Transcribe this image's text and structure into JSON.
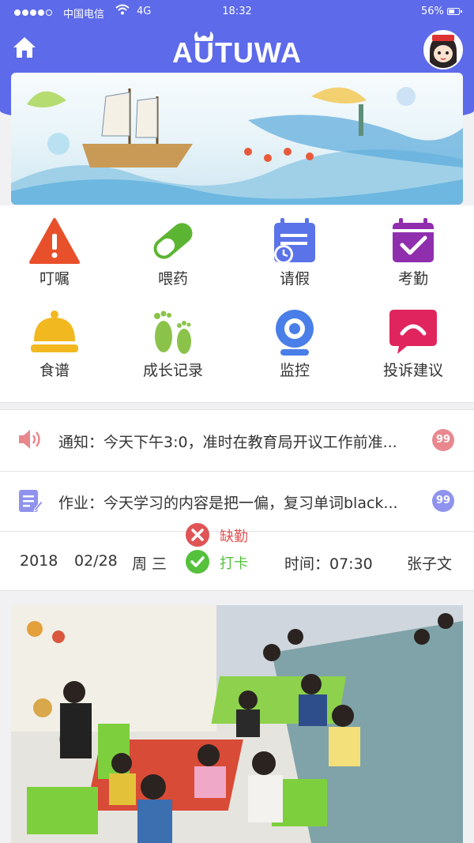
{
  "status_bar": {
    "carrier": "中国电信",
    "network": "4G",
    "time": "18:32",
    "battery": "56%"
  },
  "header": {
    "logo_text": "AUTUWA",
    "home_icon": "home-icon",
    "avatar_icon": "user-avatar"
  },
  "menu": [
    {
      "label": "叮嘱",
      "icon": "warning-icon",
      "color": "#e8502b"
    },
    {
      "label": "喂药",
      "icon": "pill-icon",
      "color": "#5bb532"
    },
    {
      "label": "请假",
      "icon": "calendar-clock-icon",
      "color": "#5b73e8"
    },
    {
      "label": "考勤",
      "icon": "calendar-check-icon",
      "color": "#8f2fae"
    },
    {
      "label": "食谱",
      "icon": "food-cover-icon",
      "color": "#f2b820"
    },
    {
      "label": "成长记录",
      "icon": "footprint-icon",
      "color": "#8bc34a"
    },
    {
      "label": "监控",
      "icon": "camera-icon",
      "color": "#4a7ee8"
    },
    {
      "label": "投诉建议",
      "icon": "complaint-bubble-icon",
      "color": "#e0255e"
    }
  ],
  "notices": [
    {
      "text": "通知：今天下午3:0，准时在教育局开议工作前准...",
      "badge": "99",
      "icon": "speaker-icon",
      "badge_color": "#e8888e"
    },
    {
      "text": "作业：今天学习的内容是把一偏，复习单词black...",
      "badge": "99",
      "icon": "homework-icon",
      "badge_color": "#8f93ee"
    }
  ],
  "attendance": {
    "year": "2018",
    "date": "02/28",
    "weekday": "周 三",
    "absent_label": "缺勤",
    "checkin_label": "打卡",
    "time_label": "时间：07:30",
    "name": "张子文"
  }
}
